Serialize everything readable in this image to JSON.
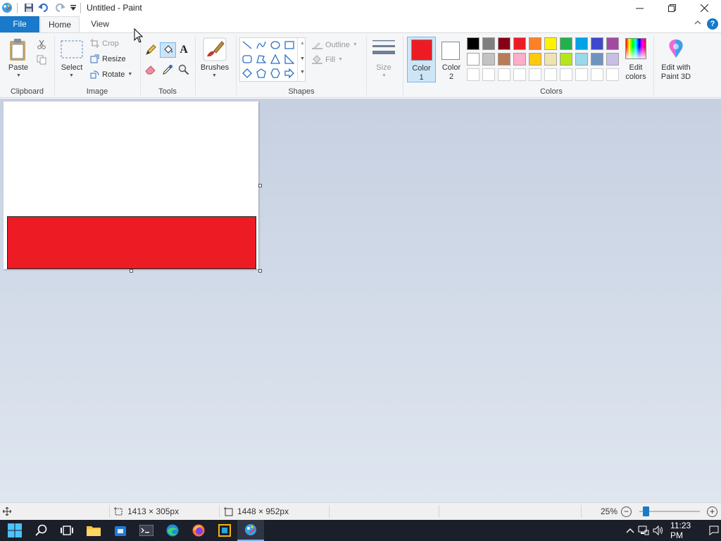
{
  "window": {
    "title": "Untitled - Paint"
  },
  "tabs": {
    "file": "File",
    "home": "Home",
    "view": "View"
  },
  "ribbon": {
    "clipboard": {
      "label": "Clipboard",
      "paste": "Paste"
    },
    "image": {
      "label": "Image",
      "select": "Select",
      "crop": "Crop",
      "resize": "Resize",
      "rotate": "Rotate"
    },
    "tools": {
      "label": "Tools"
    },
    "brushes": {
      "label": "Brushes"
    },
    "shapes": {
      "label": "Shapes",
      "outline": "Outline",
      "fill": "Fill"
    },
    "size": {
      "label": "Size"
    },
    "colors": {
      "label": "Colors",
      "color1_line1": "Color",
      "color1_line2": "1",
      "color2_line1": "Color",
      "color2_line2": "2",
      "edit_line1": "Edit",
      "edit_line2": "colors",
      "paint3d_line1": "Edit with",
      "paint3d_line2": "Paint 3D",
      "color1_value": "#ed1c24",
      "color2_value": "#ffffff",
      "palette_row1": [
        "#000000",
        "#7f7f7f",
        "#880015",
        "#ed1c24",
        "#ff7f27",
        "#fff200",
        "#22b14c",
        "#00a2e8",
        "#3f48cc",
        "#a349a4"
      ],
      "palette_row2": [
        "#ffffff",
        "#c3c3c3",
        "#b97a57",
        "#ffaec9",
        "#ffc90e",
        "#efe4b0",
        "#b5e61d",
        "#99d9ea",
        "#7092be",
        "#c8bfe7"
      ]
    }
  },
  "canvas": {
    "fill_color": "#ed1c24"
  },
  "status": {
    "selection_size": "1413 × 305px",
    "image_size": "1448 × 952px",
    "zoom": "25%"
  },
  "taskbar": {
    "time": "11:23 PM"
  }
}
